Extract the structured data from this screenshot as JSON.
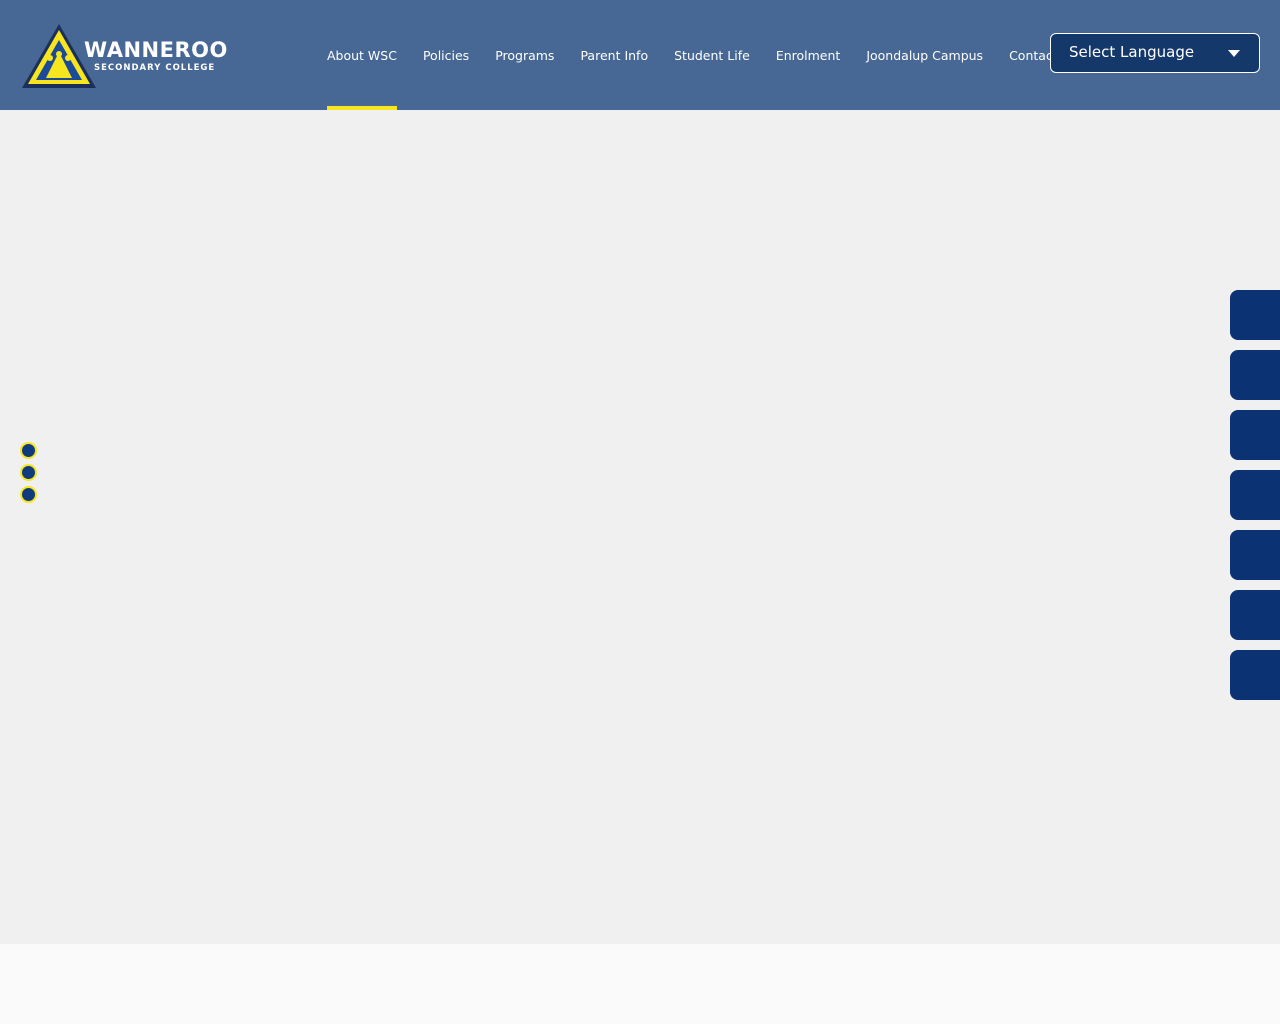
{
  "colors": {
    "header_bg": "#476795",
    "accent_yellow": "#f7e51e",
    "navy": "#0b3373",
    "hero_bg": "#f0f0f1"
  },
  "logo": {
    "name": "WANNEROO",
    "subtitle": "SECONDARY COLLEGE",
    "icon": "triangle-crest-icon"
  },
  "nav": {
    "items": [
      {
        "label": "About WSC",
        "active": true
      },
      {
        "label": "Policies"
      },
      {
        "label": "Programs"
      },
      {
        "label": "Parent Info"
      },
      {
        "label": "Student Life"
      },
      {
        "label": "Enrolment"
      },
      {
        "label": "Joondalup Campus"
      },
      {
        "label": "Contact"
      }
    ]
  },
  "language_select": {
    "selected": "Select Language",
    "icon": "chevron-down-icon"
  },
  "slider": {
    "dot_count": 3
  },
  "side_tabs": {
    "count": 7
  }
}
